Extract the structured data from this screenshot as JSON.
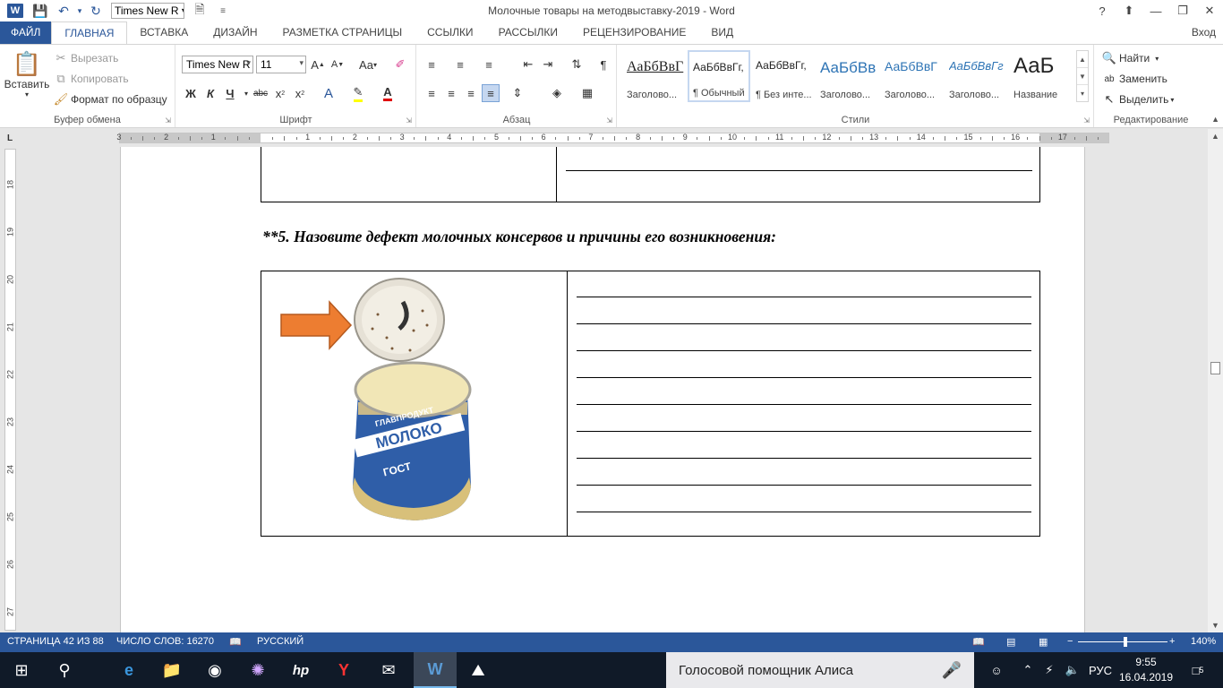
{
  "window": {
    "title": "Молочные товары на методвыставку-2019 - Word",
    "qa_font": "Times New R",
    "help": "?",
    "sign_in": "Вход"
  },
  "tabs": [
    "ФАЙЛ",
    "ГЛАВНАЯ",
    "ВСТАВКА",
    "ДИЗАЙН",
    "РАЗМЕТКА СТРАНИЦЫ",
    "ССЫЛКИ",
    "РАССЫЛКИ",
    "РЕЦЕНЗИРОВАНИЕ",
    "ВИД"
  ],
  "ribbon": {
    "clipboard": {
      "label": "Буфер обмена",
      "paste": "Вставить",
      "cut": "Вырезать",
      "copy": "Копировать",
      "format_painter": "Формат по образцу"
    },
    "font": {
      "label": "Шрифт",
      "name": "Times New R",
      "size": "11",
      "bold": "Ж",
      "italic": "К",
      "underline": "Ч",
      "strike": "abc",
      "case": "Aa"
    },
    "paragraph": {
      "label": "Абзац"
    },
    "styles": {
      "label": "Стили",
      "items": [
        {
          "preview": "АаБбВвГ",
          "name": "Заголово..."
        },
        {
          "preview": "АаБбВвГг,",
          "name": "¶ Обычный"
        },
        {
          "preview": "АаБбВвГг,",
          "name": "¶ Без инте..."
        },
        {
          "preview": "АаБбВв",
          "name": "Заголово..."
        },
        {
          "preview": "АаБбВвГ",
          "name": "Заголово..."
        },
        {
          "preview": "АаБбВвГг",
          "name": "Заголово..."
        },
        {
          "preview": "АаБ",
          "name": "Название"
        }
      ]
    },
    "editing": {
      "label": "Редактирование",
      "find": "Найти",
      "replace": "Заменить",
      "select": "Выделить"
    }
  },
  "ruler": {
    "h_numbers": [
      "3",
      "2",
      "1",
      "1",
      "2",
      "3",
      "4",
      "5",
      "6",
      "7",
      "8",
      "9",
      "10",
      "11",
      "12",
      "13",
      "14",
      "15",
      "16",
      "17"
    ],
    "v_numbers": [
      "18",
      "19",
      "20",
      "21",
      "22",
      "23",
      "24",
      "25",
      "26",
      "27"
    ]
  },
  "document": {
    "question": "**5. Назовите дефект молочных консервов и причины его возникновения:",
    "answer_lines": 9,
    "can_label_brand": "ГЛАВПРОДУКТ",
    "can_label_product": "МОЛОКО",
    "can_label_gost": "ГОСТ"
  },
  "status": {
    "page": "СТРАНИЦА 42 ИЗ 88",
    "words": "ЧИСЛО СЛОВ: 16270",
    "language": "РУССКИЙ",
    "zoom": "140%",
    "zoom_minus": "−",
    "zoom_plus": "+"
  },
  "taskbar": {
    "alice": "Голосовой помощник Алиса",
    "lang": "РУС",
    "time": "9:55",
    "date": "16.04.2019",
    "notifications": "5"
  }
}
